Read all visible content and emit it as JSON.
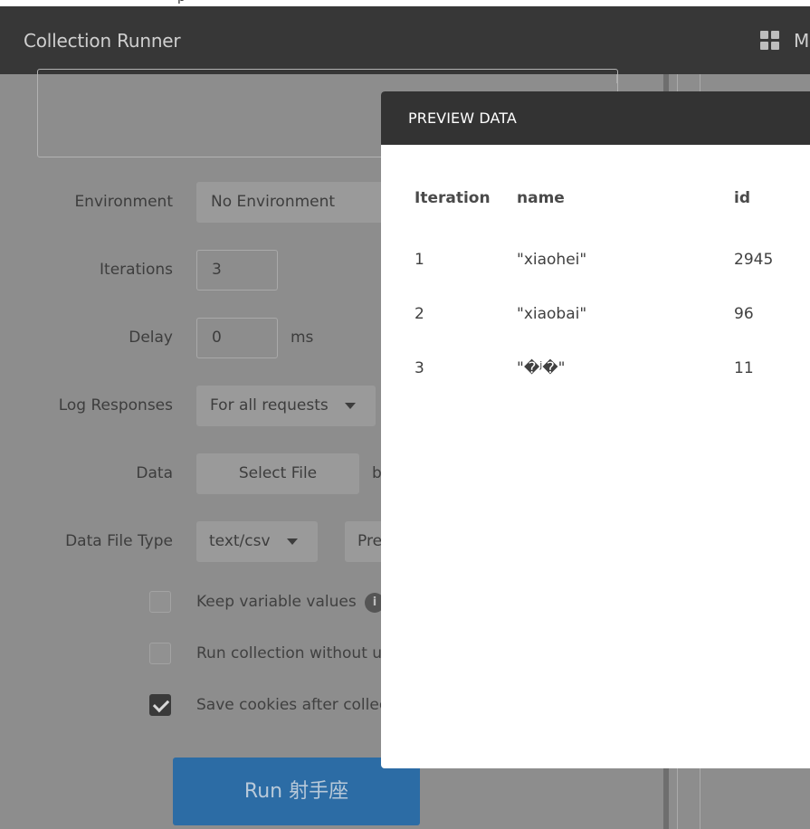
{
  "top_strip": {
    "text": "p"
  },
  "header": {
    "title": "Collection Runner",
    "right_text": "M"
  },
  "form": {
    "environment": {
      "label": "Environment",
      "value": "No Environment"
    },
    "iterations": {
      "label": "Iterations",
      "value": "3"
    },
    "delay": {
      "label": "Delay",
      "value": "0",
      "unit": "ms"
    },
    "log_responses": {
      "label": "Log Responses",
      "value": "For all requests"
    },
    "data": {
      "label": "Data",
      "button": "Select File",
      "file_text": "b"
    },
    "data_file_type": {
      "label": "Data File Type",
      "value": "text/csv",
      "preview_button": "Pre"
    },
    "options": [
      {
        "label": "Keep variable values",
        "checked": false
      },
      {
        "label": "Run collection without us",
        "checked": false
      },
      {
        "label": "Save cookies after collec",
        "checked": true
      }
    ],
    "info_glyph": "i",
    "run_button": "Run 射手座"
  },
  "modal": {
    "title": "PREVIEW DATA",
    "columns": [
      "Iteration",
      "name",
      "id"
    ],
    "rows": [
      [
        "1",
        "\"xiaohei\"",
        "2945"
      ],
      [
        "2",
        "\"xiaobai\"",
        "96"
      ],
      [
        "3",
        "\"�ʲ�\"",
        "11"
      ]
    ]
  },
  "colors": {
    "header_bg": "#373737",
    "modal_header_bg": "#333333",
    "run_button_bg": "#2c6ca5",
    "overlay_bg": "#8d8d8d"
  }
}
